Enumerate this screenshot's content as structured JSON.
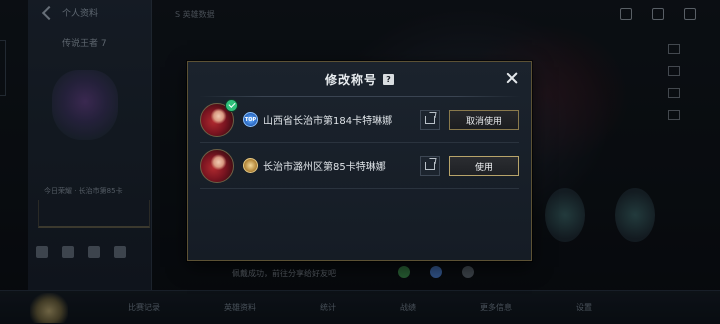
{
  "background": {
    "profile_title": "个人资料",
    "rank_text": "传说王者 7",
    "left_caption": "今日荣耀 · 长治市第85卡",
    "top_tab": "S 英雄数据",
    "notice": "佩戴成功，前往分享给好友吧",
    "bottom_tabs": [
      "比赛记录",
      "英雄资料",
      "统计",
      "战绩",
      "更多信息",
      "设置"
    ]
  },
  "modal": {
    "title": "修改称号",
    "help_glyph": "?",
    "titles": [
      {
        "text": "山西省长治市第184卡特琳娜",
        "badge_label": "TOP",
        "badge_color": "#2f6fc9",
        "equipped": true,
        "action_label": "取消使用"
      },
      {
        "text": "长治市潞州区第85卡特琳娜",
        "badge_label": "",
        "badge_color": "#b88b3e",
        "equipped": false,
        "action_label": "使用"
      }
    ]
  },
  "colors": {
    "gold_border": "#8a7a4c",
    "check_green": "#2fbf7a",
    "panel_bg": "#1b232d"
  }
}
